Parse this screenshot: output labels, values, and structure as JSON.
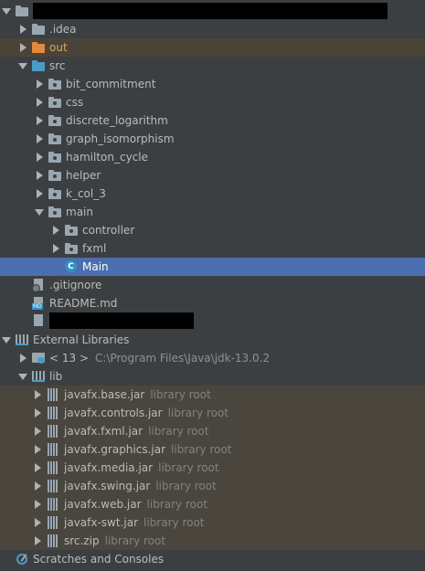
{
  "project": {
    "name": ""
  },
  "tree": {
    "idea": ".idea",
    "out": "out",
    "src": "src",
    "packages": [
      "bit_commitment",
      "css",
      "discrete_logarithm",
      "graph_isomorphism",
      "hamilton_cycle",
      "helper",
      "k_col_3"
    ],
    "main": "main",
    "main_children": [
      "controller",
      "fxml"
    ],
    "main_class": "Main",
    "gitignore": ".gitignore",
    "readme": "README.md",
    "hidden_file": ""
  },
  "external_libraries": {
    "label": "External Libraries",
    "jdk_label": "< 13 >",
    "jdk_path": "C:\\Program Files\\Java\\jdk-13.0.2",
    "lib_label": "lib",
    "library_root": "library root",
    "jars": [
      "javafx.base.jar",
      "javafx.controls.jar",
      "javafx.fxml.jar",
      "javafx.graphics.jar",
      "javafx.media.jar",
      "javafx.swing.jar",
      "javafx.web.jar",
      "javafx-swt.jar",
      "src.zip"
    ]
  },
  "scratches": "Scratches and Consoles",
  "colors": {
    "background": "#3c3f41",
    "selection": "#4b6eaf",
    "excluded_bg": "#4a4438",
    "library_bg": "#4a463d"
  }
}
